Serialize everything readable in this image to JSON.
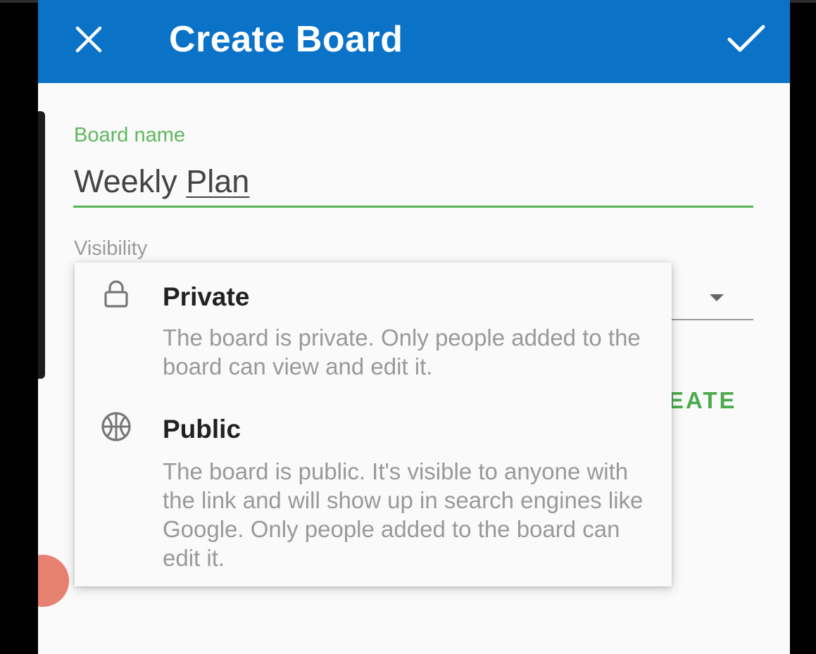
{
  "header": {
    "title": "Create Board",
    "close_icon": "close-icon",
    "confirm_icon": "check-icon",
    "background_color": "#0a73c8"
  },
  "form": {
    "board_name_label": "Board name",
    "board_name_value_first": "Weekly",
    "board_name_value_last": "Plan",
    "visibility_label": "Visibility",
    "create_button_partial": "EATE"
  },
  "visibility_menu": {
    "options": [
      {
        "icon": "lock-icon",
        "title": "Private",
        "description": "The board is private. Only people added to the board can view and edit it."
      },
      {
        "icon": "globe-icon",
        "title": "Public",
        "description": "The board is public. It's visible to anyone with the link and will show up in search engines like Google. Only people added to the board can edit it."
      }
    ]
  },
  "colors": {
    "accent_green": "#58b558",
    "app_bar_blue": "#0a73c8"
  }
}
